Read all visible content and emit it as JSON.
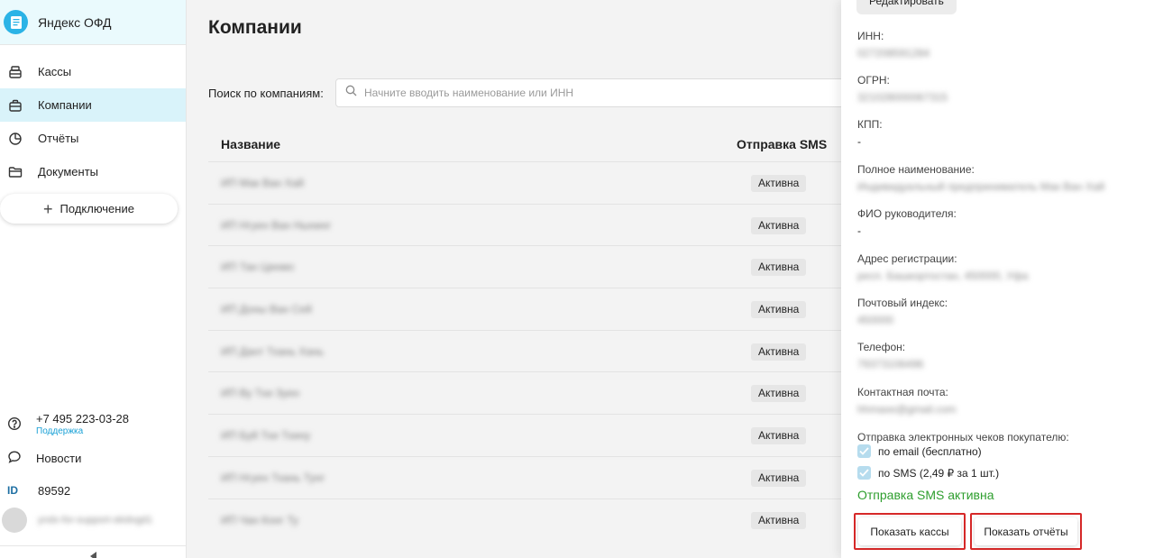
{
  "brand": {
    "title": "Яндекс ОФД"
  },
  "nav": [
    {
      "label": "Кассы",
      "icon": "cashbox-icon"
    },
    {
      "label": "Компании",
      "icon": "company-icon",
      "active": true
    },
    {
      "label": "Отчёты",
      "icon": "report-icon"
    },
    {
      "label": "Документы",
      "icon": "folder-icon"
    }
  ],
  "connect_label": "Подключение",
  "sidebar_bottom": {
    "phone": "+7 495 223-03-28",
    "support": "Поддержка",
    "news": "Новости",
    "id_label": "ID",
    "id_value": "89592",
    "user": "yndx-for-support-skidvgd1"
  },
  "main": {
    "title": "Компании",
    "search_label": "Поиск по компаниям:",
    "search_placeholder": "Начните вводить наименование или ИНН",
    "columns": {
      "name": "Название",
      "sms": "Отправка SMS"
    },
    "rows": [
      {
        "name": "ИП Мак Ван Хай",
        "sms": "Активна"
      },
      {
        "name": "ИП Нгуен Ван Нынинг",
        "sms": "Активна"
      },
      {
        "name": "ИП Тан Цинмо",
        "sms": "Активна"
      },
      {
        "name": "ИП Доны Ван Сей",
        "sms": "Активна"
      },
      {
        "name": "ИП Дант Тхань Хань",
        "sms": "Активна"
      },
      {
        "name": "ИП Ву Тхи Зуен",
        "sms": "Активна"
      },
      {
        "name": "ИП Буй Тхи Тхину",
        "sms": "Активна"
      },
      {
        "name": "ИП Нгуен Тхань Тунг",
        "sms": "Активна"
      },
      {
        "name": "ИП Чан Конг Ту",
        "sms": "Активна"
      }
    ]
  },
  "panel": {
    "edit_label": "Редактировать",
    "fields": [
      {
        "label": "ИНН:",
        "value": "027208591284",
        "blurred": true
      },
      {
        "label": "ОГРН:",
        "value": "321028000067315",
        "blurred": true
      },
      {
        "label": "КПП:",
        "value": "-",
        "blurred": false
      },
      {
        "label": "Полное наименование:",
        "value": "Индивидуальный предприниматель Мак Ван Хай",
        "blurred": true
      },
      {
        "label": "ФИО руководителя:",
        "value": "-",
        "blurred": false
      },
      {
        "label": "Адрес регистрации:",
        "value": "респ. Башкортостан, 450000, Уфа",
        "blurred": true
      },
      {
        "label": "Почтовый индекс:",
        "value": "450000",
        "blurred": true
      },
      {
        "label": "Телефон:",
        "value": "79373106496",
        "blurred": true
      },
      {
        "label": "Контактная почта:",
        "value": "hhmaxe@gmail.com",
        "blurred": true
      }
    ],
    "checks_title": "Отправка электронных чеков покупателю:",
    "check_email": "по email (бесплатно)",
    "check_sms": "по SMS (2,49 ₽ за 1 шт.)",
    "sms_status": "Отправка SMS активна",
    "btn_cashboxes": "Показать кассы",
    "btn_reports": "Показать отчёты",
    "status_color": "#2e9e2e",
    "accent_color": "#2bb3e6"
  }
}
